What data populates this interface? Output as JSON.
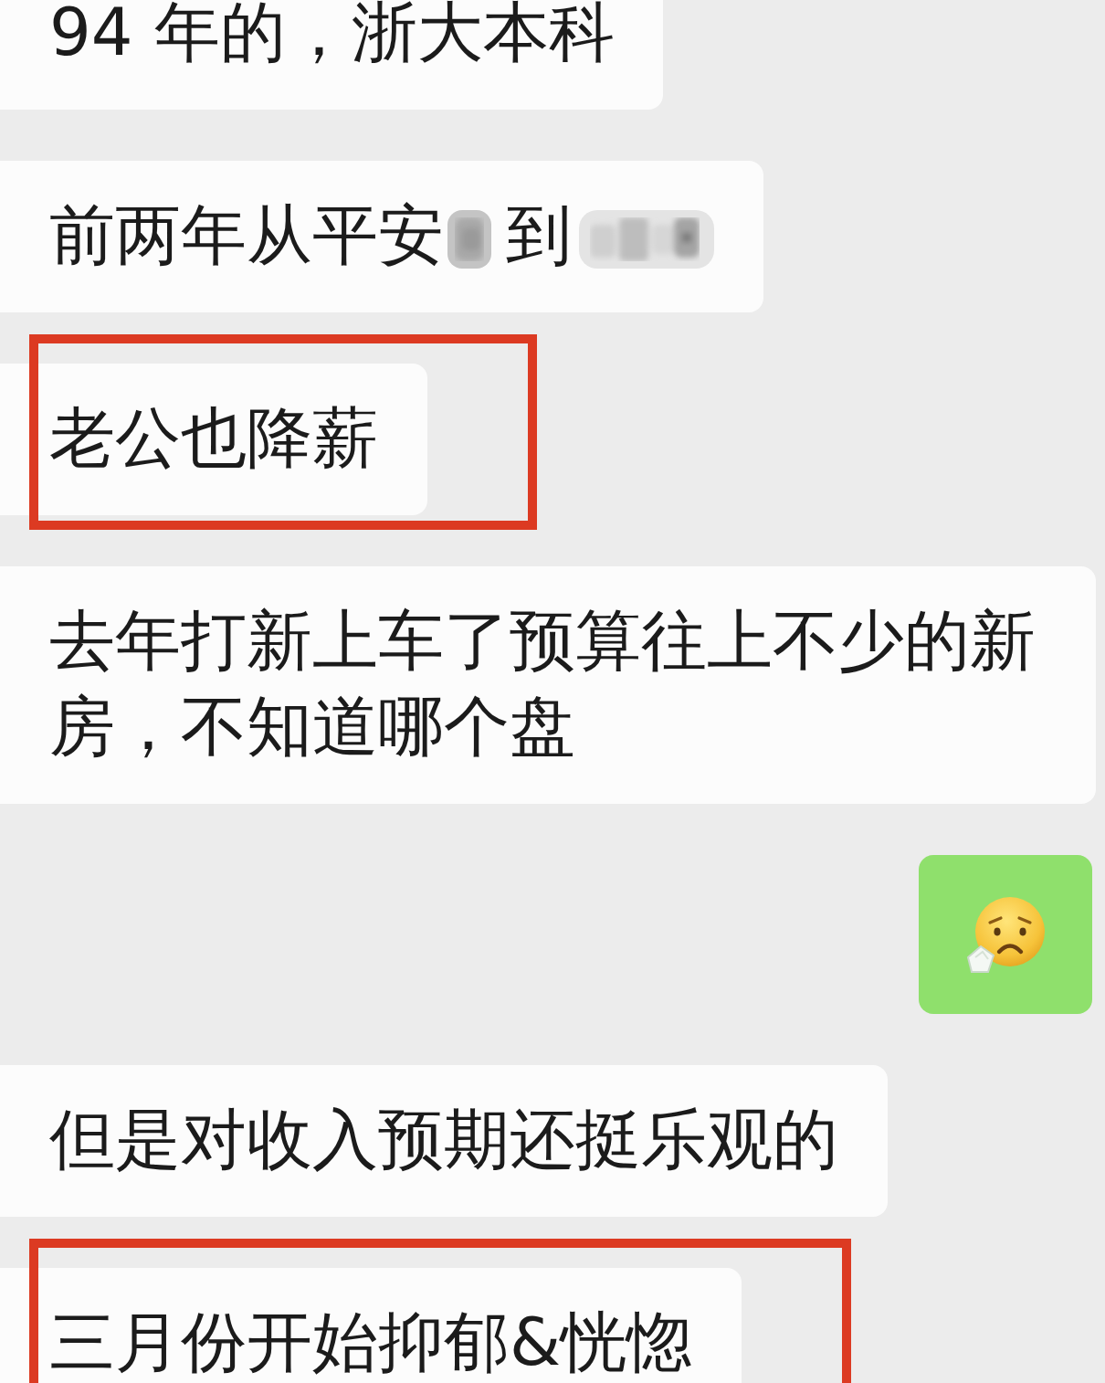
{
  "messages": [
    {
      "outgoing": false,
      "highlighted": false,
      "content": [
        {
          "kind": "text",
          "text": "94 年的，浙大本科"
        }
      ]
    },
    {
      "outgoing": false,
      "highlighted": false,
      "content": [
        {
          "kind": "text",
          "text": "前两年从平安"
        },
        {
          "kind": "redacted"
        },
        {
          "kind": "text",
          "text": "到"
        },
        {
          "kind": "redacted"
        }
      ]
    },
    {
      "outgoing": false,
      "highlighted": true,
      "content": [
        {
          "kind": "text",
          "text": "老公也降薪"
        }
      ]
    },
    {
      "outgoing": false,
      "highlighted": false,
      "content": [
        {
          "kind": "text",
          "text": "去年打新上车了预算往上不少的新房，不知道哪个盘"
        }
      ]
    },
    {
      "outgoing": true,
      "highlighted": false,
      "content": [
        {
          "kind": "emoji"
        }
      ]
    },
    {
      "outgoing": false,
      "highlighted": false,
      "content": [
        {
          "kind": "text",
          "text": "但是对收入预期还挺乐观的"
        }
      ]
    },
    {
      "outgoing": false,
      "highlighted": true,
      "content": [
        {
          "kind": "text",
          "text": "三月份开始抑郁&恍惚"
        }
      ]
    }
  ]
}
